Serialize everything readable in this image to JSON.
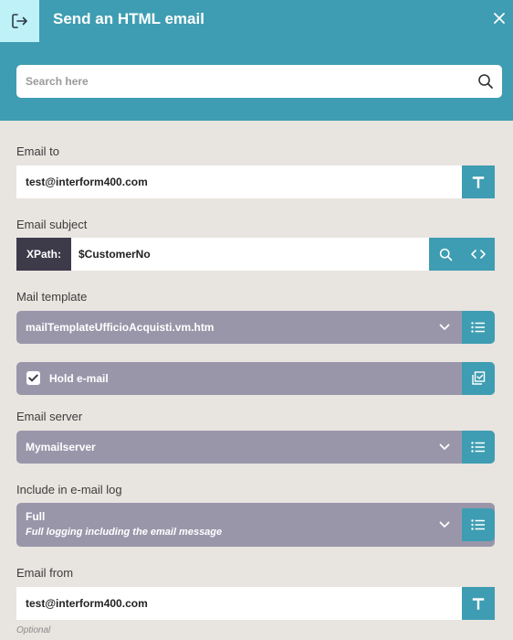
{
  "header": {
    "exit_icon": "exit-icon",
    "title": "Send an HTML email",
    "close_icon": "close-icon",
    "colors": {
      "header_bg": "#3e9db2",
      "exit_bg": "#bff1f8"
    }
  },
  "search": {
    "placeholder": "Search here",
    "icon": "search-icon"
  },
  "email_to": {
    "label": "Email to",
    "value": "test@interform400.com",
    "button_icon": "text-t-icon"
  },
  "email_subject": {
    "label": "Email subject",
    "xpath_tag": "XPath:",
    "value": "$CustomerNo",
    "buttons": [
      "search-icon",
      "code-icon"
    ]
  },
  "mail_template": {
    "label": "Mail template",
    "value": "mailTemplateUfficioAcquisti.vm.htm",
    "button_icon": "list-icon"
  },
  "hold_email": {
    "label": "Hold e-mail",
    "checked": true,
    "button_icon": "checkbox-list-icon"
  },
  "email_server": {
    "label": "Email server",
    "value": "Mymailserver",
    "button_icon": "list-icon"
  },
  "email_log": {
    "label": "Include in e-mail log",
    "value": "Full",
    "description": "Full logging including the email message",
    "button_icon": "list-icon"
  },
  "email_from": {
    "label": "Email from",
    "value": "test@interform400.com",
    "button_icon": "text-t-icon",
    "hint": "Optional"
  },
  "colors": {
    "accent": "#3e9db2",
    "select_bg": "#9a96aa",
    "page_bg": "#e8e4e0",
    "xpath_bg": "#3d3a4a"
  }
}
